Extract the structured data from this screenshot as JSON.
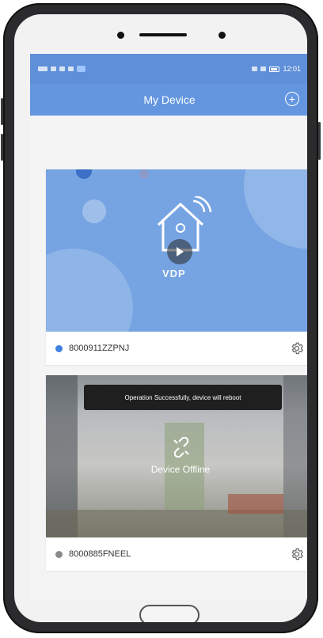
{
  "status_bar": {
    "left_text": "",
    "time": "12:01"
  },
  "header": {
    "title": "My Device",
    "add_icon": "plus-circle-icon"
  },
  "devices": [
    {
      "id": "8000911ZZPNJ",
      "online": true,
      "thumbnail_label": "VDP",
      "status_color": "#3d82e0"
    },
    {
      "id": "8000885FNEEL",
      "online": false,
      "offline_label": "Device Offline",
      "status_color": "#8a8a8a"
    }
  ],
  "toast": {
    "message": "Operation Successfully, device will reboot"
  },
  "colors": {
    "accent": "#6496e0",
    "status_bar": "#5f8fd8"
  }
}
